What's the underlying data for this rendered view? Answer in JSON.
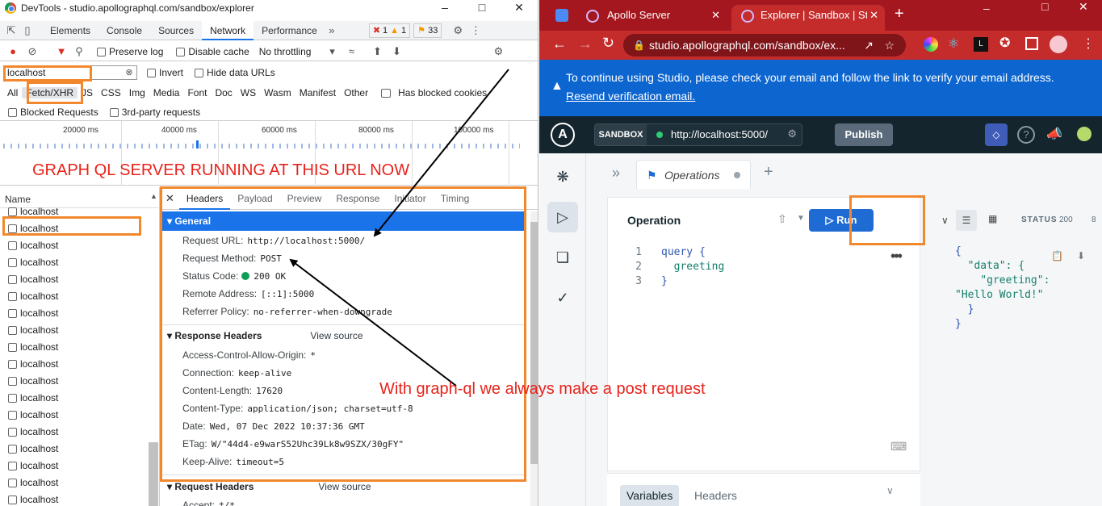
{
  "devtools": {
    "window_title": "DevTools - studio.apollographql.com/sandbox/explorer",
    "panel_tabs": [
      "Elements",
      "Console",
      "Sources",
      "Network",
      "Performance"
    ],
    "active_panel": "Network",
    "badges": {
      "errors": "1",
      "warnings": "1",
      "issues": "33"
    },
    "toolbar": {
      "preserve_log": "Preserve log",
      "disable_cache": "Disable cache",
      "throttling": "No throttling"
    },
    "filter": {
      "value": "localhost",
      "invert": "Invert",
      "hide_data_urls": "Hide data URLs"
    },
    "type_filters": [
      "All",
      "Fetch/XHR",
      "JS",
      "CSS",
      "Img",
      "Media",
      "Font",
      "Doc",
      "WS",
      "Wasm",
      "Manifest",
      "Other"
    ],
    "active_type": "Fetch/XHR",
    "has_blocked_cookies": "Has blocked cookies",
    "blocked_requests": "Blocked Requests",
    "third_party": "3rd-party requests",
    "timeline_ticks": [
      "20000 ms",
      "40000 ms",
      "60000 ms",
      "80000 ms",
      "100000 ms"
    ],
    "name_header": "Name",
    "requests": [
      "localhost",
      "localhost",
      "localhost",
      "localhost",
      "localhost",
      "localhost",
      "localhost",
      "localhost",
      "localhost",
      "localhost",
      "localhost",
      "localhost",
      "localhost",
      "localhost",
      "localhost",
      "localhost",
      "localhost",
      "localhost"
    ],
    "detail_tabs": [
      "Headers",
      "Payload",
      "Preview",
      "Response",
      "Initiator",
      "Timing"
    ],
    "active_detail_tab": "Headers",
    "general": {
      "title": "General",
      "request_url_label": "Request URL:",
      "request_url": "http://localhost:5000/",
      "method_label": "Request Method:",
      "method": "POST",
      "status_label": "Status Code:",
      "status": "200 OK",
      "remote_label": "Remote Address:",
      "remote": "[::1]:5000",
      "referrer_label": "Referrer Policy:",
      "referrer": "no-referrer-when-downgrade"
    },
    "response_headers": {
      "title": "Response Headers",
      "view_source": "View source",
      "acao_label": "Access-Control-Allow-Origin:",
      "acao": "*",
      "conn_label": "Connection:",
      "conn": "keep-alive",
      "len_label": "Content-Length:",
      "len": "17620",
      "type_label": "Content-Type:",
      "type": "application/json; charset=utf-8",
      "date_label": "Date:",
      "date": "Wed, 07 Dec 2022 10:37:36 GMT",
      "etag_label": "ETag:",
      "etag": "W/\"44d4-e9warS52Uhc39Lk8w9SZX/30gFY\"",
      "ka_label": "Keep-Alive:",
      "ka": "timeout=5"
    },
    "request_headers": {
      "title": "Request Headers",
      "view_source": "View source",
      "accept_label": "Accept:",
      "accept": "*/*"
    }
  },
  "annotations": {
    "server_running": "GRAPH QL SERVER RUNNING AT THIS URL NOW",
    "post_request": "With graph-ql we always make a post request"
  },
  "browser": {
    "tabs": [
      "Apollo Server",
      "Explorer | Sandbox | Stu"
    ],
    "url": "studio.apollographql.com/sandbox/ex...",
    "info_message": "To continue using Studio, please check your email and follow the link to verify your email address.",
    "info_link": "Resend verification email."
  },
  "studio": {
    "sandbox_label": "SANDBOX",
    "endpoint": "http://localhost:5000/",
    "publish": "Publish",
    "operations_tab": "Operations",
    "operation_title": "Operation",
    "run": "Run",
    "status_label": "STATUS",
    "status_code": "200",
    "status_extra": "8",
    "query_lines": [
      "query {",
      "  greeting",
      "}"
    ],
    "response_lines": [
      "{",
      "  \"data\": {",
      "    \"greeting\":",
      "\"Hello World!\"",
      "  }",
      "}"
    ],
    "variables_tab": "Variables",
    "headers_tab": "Headers"
  },
  "colors": {
    "accent": "#1a73e8",
    "annotation_red": "#e8231b",
    "highlight_orange": "#f2882d",
    "browser_red": "#c42b2b",
    "apollo_dark": "#15252d",
    "run_blue": "#1f6bd4"
  }
}
